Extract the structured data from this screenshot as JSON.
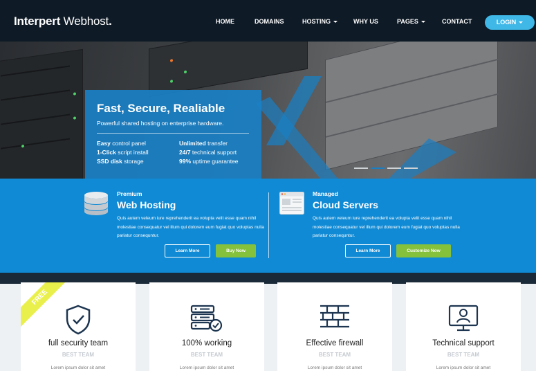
{
  "brand": {
    "name_bold": "Interpert",
    "name_light": " Webhost",
    "dot": "."
  },
  "nav": {
    "items": [
      {
        "label": "HOME",
        "dropdown": false
      },
      {
        "label": "DOMAINS",
        "dropdown": false
      },
      {
        "label": "HOSTING",
        "dropdown": true
      },
      {
        "label": "WHY US",
        "dropdown": false
      },
      {
        "label": "PAGES",
        "dropdown": true
      },
      {
        "label": "CONTACT",
        "dropdown": false
      }
    ],
    "login_label": "LOGIN"
  },
  "hero": {
    "title": "Fast, Secure, Realiable",
    "subtitle": "Powerful shared hosting on enterprise hardware.",
    "features": [
      {
        "bold": "Easy",
        "text": " control panel"
      },
      {
        "bold": "Unlimited",
        "text": " transfer"
      },
      {
        "bold": "1-Click",
        "text": " script install"
      },
      {
        "bold": "24/7",
        "text": " technical support"
      },
      {
        "bold": "SSD disk",
        "text": " storage"
      },
      {
        "bold": "99%",
        "text": " uptime guarantee"
      }
    ],
    "slide_count": 4,
    "active_slide": 2
  },
  "plans": [
    {
      "kicker": "Premium",
      "title": "Web Hosting",
      "icon": "database-icon",
      "description": "Quis autem veleum iure reprehenderit ea volupta velit esse quam nihil molestiae consequatur vel illum qui dolorem eum fugiat quo voluptas nulla pariatur consequntur.",
      "learn_more": "Learn More",
      "action": "Buy Now"
    },
    {
      "kicker": "Managed",
      "title": "Cloud Servers",
      "icon": "browser-window-icon",
      "description": "Quis autem veleum iure reprehenderit ea volupta velit esse quam nihil molestiae consequatur vel illum qui dolorem eum fugiat quo voluptas nulla pariatur consequntur.",
      "learn_more": "Learn More",
      "action": "Customize Now"
    }
  ],
  "features": [
    {
      "title": "full security team",
      "subtitle": "BEST TEAM",
      "icon": "shield-check-icon",
      "lorem": "Lorem ipsum dolor sit amet",
      "ribbon": "FREE"
    },
    {
      "title": "100% working",
      "subtitle": "BEST TEAM",
      "icon": "server-check-icon",
      "lorem": "Lorem ipsum dolor sit amet"
    },
    {
      "title": "Effective firewall",
      "subtitle": "BEST TEAM",
      "icon": "brick-wall-icon",
      "lorem": "Lorem ipsum dolor sit amet"
    },
    {
      "title": "Technical support",
      "subtitle": "BEST TEAM",
      "icon": "monitor-user-icon",
      "lorem": "Lorem ipsum dolor sit amet"
    }
  ],
  "colors": {
    "nav_bg": "#0e1a26",
    "accent_blue": "#108ad4",
    "login_bg": "#3fb8e8",
    "green": "#86c13c",
    "icon_navy": "#1d3550",
    "ribbon_yellow": "#eaf04b"
  }
}
